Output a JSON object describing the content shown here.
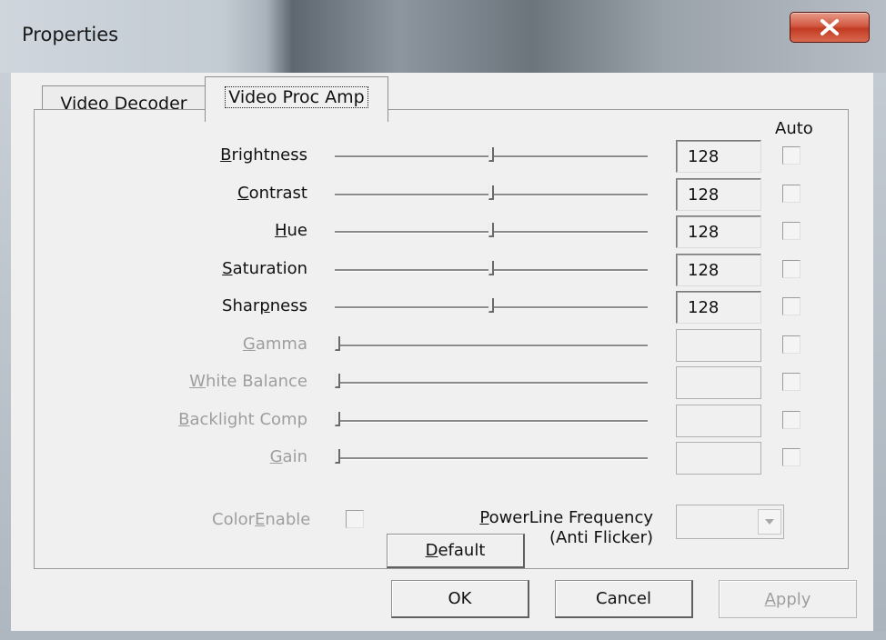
{
  "window": {
    "title": "Properties"
  },
  "tabs": [
    {
      "label": "Video Decoder",
      "active": false
    },
    {
      "label": "Video Proc Amp",
      "active": true
    }
  ],
  "auto_header": "Auto",
  "controls": [
    {
      "label": "Brightness",
      "mnemonic": "B",
      "value": "128",
      "enabled": true,
      "slider_fraction": 0.5
    },
    {
      "label": "Contrast",
      "mnemonic": "C",
      "value": "128",
      "enabled": true,
      "slider_fraction": 0.5
    },
    {
      "label": "Hue",
      "mnemonic": "H",
      "value": "128",
      "enabled": true,
      "slider_fraction": 0.5
    },
    {
      "label": "Saturation",
      "mnemonic": "S",
      "value": "128",
      "enabled": true,
      "slider_fraction": 0.5
    },
    {
      "label": "Sharpness",
      "mnemonic": "p",
      "value": "128",
      "enabled": true,
      "slider_fraction": 0.5
    },
    {
      "label": "Gamma",
      "mnemonic": "G",
      "value": "",
      "enabled": false,
      "slider_fraction": 0.0
    },
    {
      "label": "White Balance",
      "mnemonic": "W",
      "value": "",
      "enabled": false,
      "slider_fraction": 0.0
    },
    {
      "label": "Backlight Comp",
      "mnemonic": "B",
      "value": "",
      "enabled": false,
      "slider_fraction": 0.0
    },
    {
      "label": "Gain",
      "mnemonic": "G",
      "value": "",
      "enabled": false,
      "slider_fraction": 0.0
    }
  ],
  "color_enable": {
    "label": "ColorEnable",
    "checked": false,
    "enabled": false
  },
  "powerline": {
    "label_line1": "PowerLine Frequency",
    "label_line2": "(Anti Flicker)",
    "value": ""
  },
  "buttons": {
    "default": "Default",
    "ok": "OK",
    "cancel": "Cancel",
    "apply": "Apply"
  },
  "colors": {
    "close_button": "#c9452c",
    "disabled_text": "#9e9e9e",
    "dialog_bg": "#f0f0f0"
  }
}
